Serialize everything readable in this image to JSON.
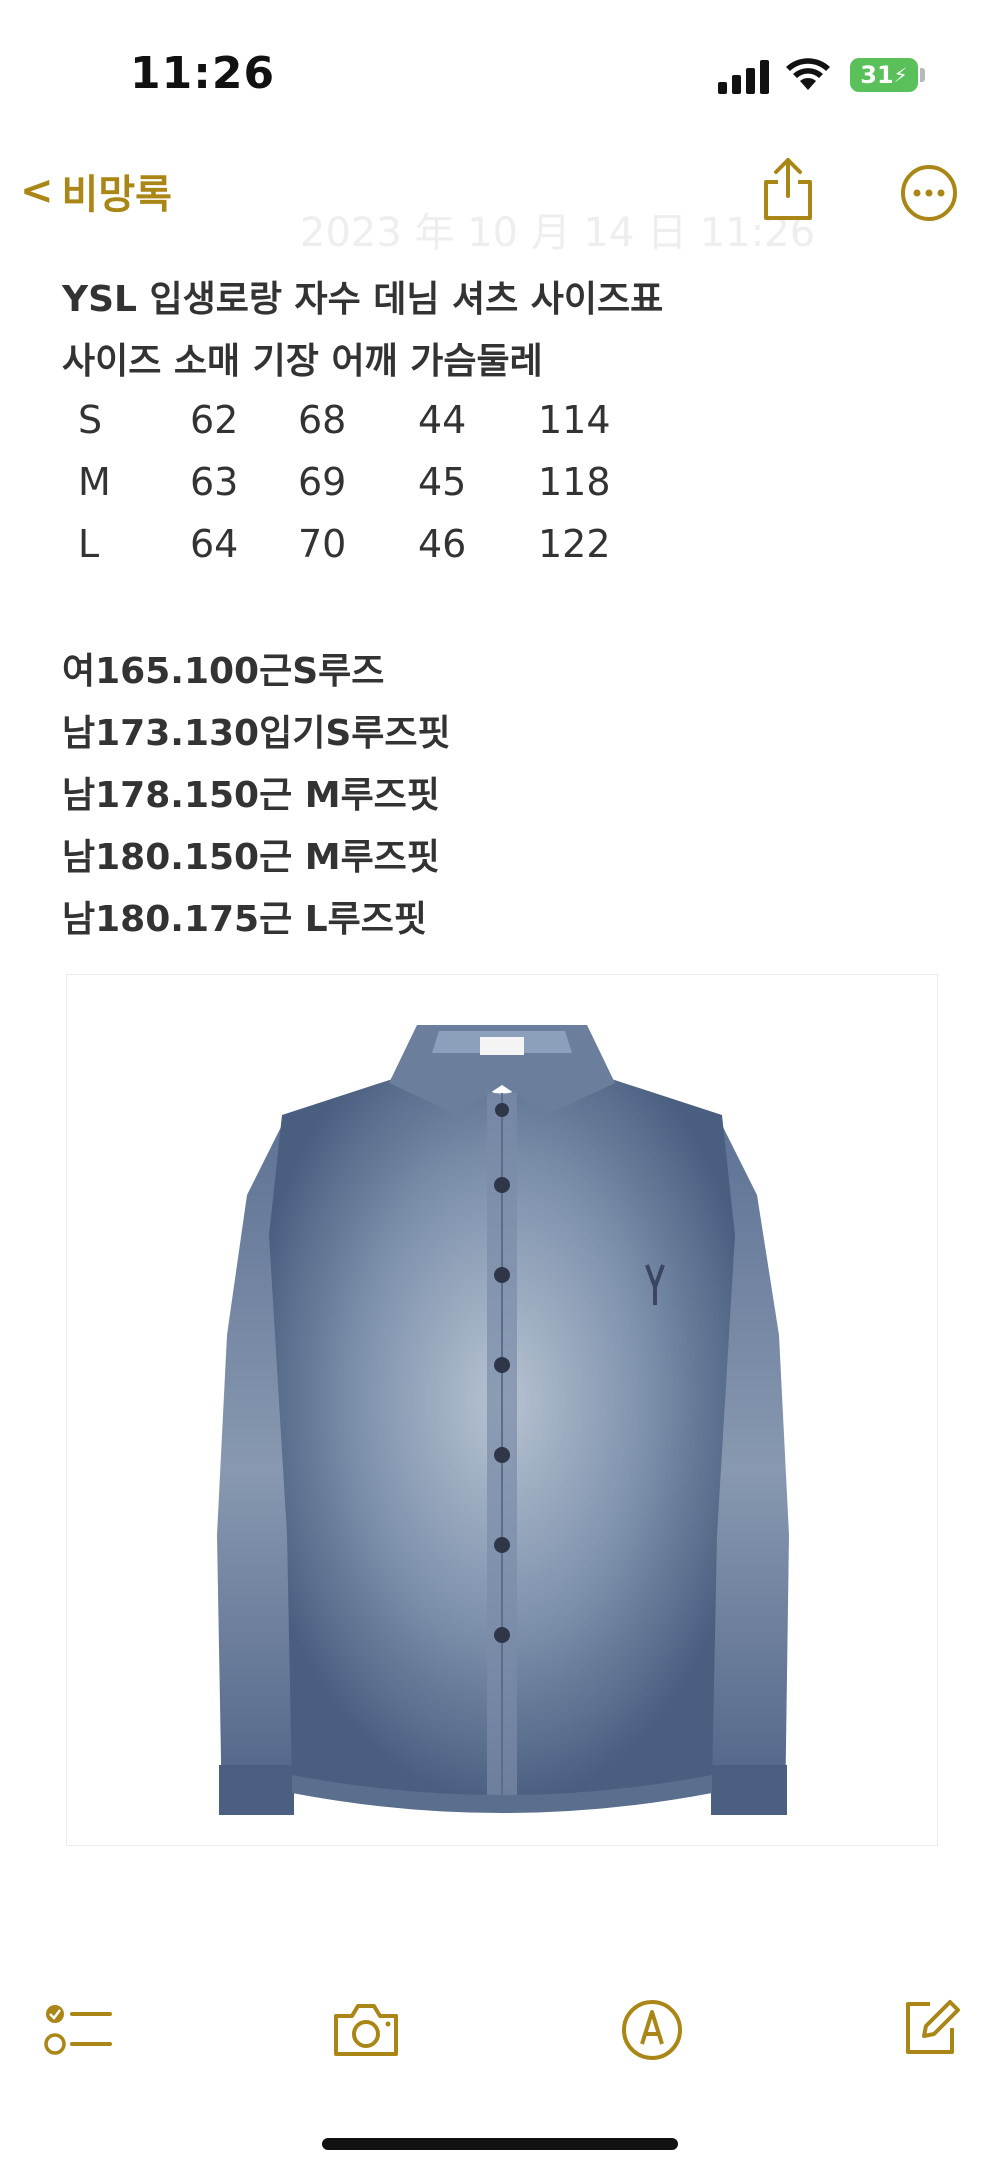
{
  "status_bar": {
    "time": "11:26",
    "battery": "31"
  },
  "nav": {
    "back_label": "비망록",
    "back_chevron": "<",
    "faded_timestamp": "2023 年 10 月 14 日 11:26"
  },
  "note": {
    "title": "YSL 입생로랑 자수 데님 셔츠 사이즈표",
    "table_header": "사이즈 소매 기장 어깨 가슴둘레",
    "rows": [
      [
        "S",
        "62",
        "68",
        "44",
        "114"
      ],
      [
        "M",
        "63",
        "69",
        "45",
        "118"
      ],
      [
        "L",
        "64",
        "70",
        "46",
        "122"
      ]
    ],
    "fits": [
      "여165.100근S루즈",
      "남173.130입기S루즈핏",
      "남178.150근 M루즈핏",
      "남180.150근 M루즈핏",
      "남180.175근 L루즈핏"
    ]
  },
  "image": {
    "description_label": "denim-shirt-photo"
  },
  "colors": {
    "accent": "#a98615",
    "battery": "#5ac05a",
    "text": "#333333"
  },
  "toolbar": {
    "icons": [
      "checklist-icon",
      "camera-icon",
      "markup-icon",
      "compose-icon"
    ]
  }
}
